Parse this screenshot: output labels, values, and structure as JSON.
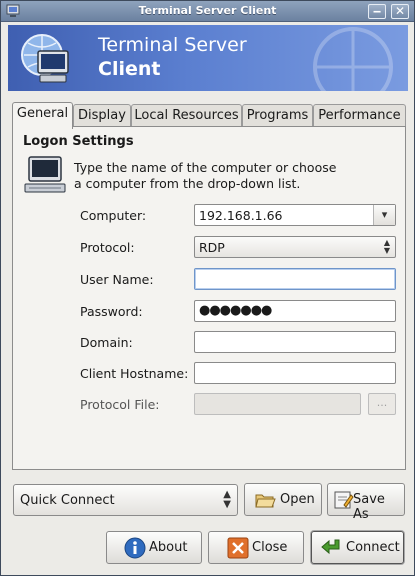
{
  "window": {
    "title": "Terminal Server Client"
  },
  "banner": {
    "line1": "Terminal Server",
    "line2": "Client"
  },
  "tabs": [
    {
      "label": "General",
      "active": true
    },
    {
      "label": "Display",
      "active": false
    },
    {
      "label": "Local Resources",
      "active": false
    },
    {
      "label": "Programs",
      "active": false
    },
    {
      "label": "Performance",
      "active": false
    }
  ],
  "logon": {
    "section_title": "Logon Settings",
    "intro_line1": "Type the name of the computer or choose",
    "intro_line2": "a computer from the drop-down list.",
    "computer_label": "Computer:",
    "computer_value": "192.168.1.66",
    "protocol_label": "Protocol:",
    "protocol_value": "RDP",
    "username_label": "User Name:",
    "username_value": "",
    "password_label": "Password:",
    "password_value": "●●●●●●●",
    "domain_label": "Domain:",
    "domain_value": "",
    "hostname_label": "Client Hostname:",
    "hostname_value": "",
    "protocol_file_label": "Protocol File:",
    "protocol_file_value": "",
    "browse_label": "..."
  },
  "quick": {
    "selected": "Quick Connect",
    "open_label": "Open",
    "save_as_label": "Save As"
  },
  "actions": {
    "about_label": "About",
    "close_label": "Close",
    "connect_label": "Connect"
  },
  "colors": {
    "banner_start": "#3f5fb1",
    "banner_end": "#7a9be0",
    "close_icon": "#e0702c",
    "connect_icon": "#4a9b2e",
    "about_icon": "#2f6bbf"
  }
}
